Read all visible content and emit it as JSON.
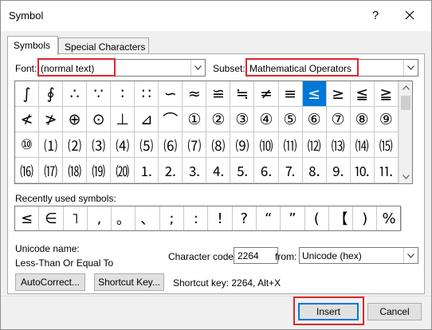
{
  "window": {
    "title": "Symbol",
    "help_glyph": "?"
  },
  "tabs": [
    {
      "label": "Symbols",
      "active": true
    },
    {
      "label": "Special Characters",
      "active": false
    }
  ],
  "font": {
    "label": "Font:",
    "value": "(normal text)"
  },
  "subset": {
    "label": "Subset:",
    "value": "Mathematical Operators"
  },
  "symbol_grid": {
    "selected_index": 12,
    "rows": [
      [
        "∫",
        "∮",
        "∴",
        "∵",
        "∶",
        "∷",
        "∽",
        "≈",
        "≌",
        "≒",
        "≠",
        "≡",
        "≤",
        "≥",
        "≦",
        "≧"
      ],
      [
        "≮",
        "≯",
        "⊕",
        "⊙",
        "⊥",
        "⊿",
        "⌒",
        "①",
        "②",
        "③",
        "④",
        "⑤",
        "⑥",
        "⑦",
        "⑧",
        "⑨"
      ],
      [
        "⑩",
        "⑴",
        "⑵",
        "⑶",
        "⑷",
        "⑸",
        "⑹",
        "⑺",
        "⑻",
        "⑼",
        "⑽",
        "⑾",
        "⑿",
        "⒀",
        "⒁",
        "⒂"
      ],
      [
        "⒃",
        "⒄",
        "⒅",
        "⒆",
        "⒇",
        "⒈",
        "⒉",
        "⒊",
        "⒋",
        "⒌",
        "⒍",
        "⒎",
        "⒏",
        "⒐",
        "⒑",
        "⒒"
      ]
    ]
  },
  "recently_used": {
    "label": "Recently used symbols:",
    "symbols": [
      "≤",
      "∈",
      "˥",
      ",",
      "。",
      "、",
      ";",
      ":",
      "!",
      "?",
      "“",
      "”",
      "(",
      "【",
      ")",
      "%"
    ]
  },
  "unicode_name": {
    "label": "Unicode name:",
    "value": "Less-Than Or Equal To"
  },
  "character_code": {
    "label": "Character code:",
    "value": "2264"
  },
  "from": {
    "label": "from:",
    "value": "Unicode (hex)"
  },
  "buttons": {
    "autocorrect": "AutoCorrect...",
    "shortcut_key": "Shortcut Key...",
    "insert": "Insert",
    "cancel": "Cancel"
  },
  "shortcut_text": "Shortcut key: 2264, Alt+X",
  "colors": {
    "selection": "#0078d7",
    "highlight_box": "#e0262c"
  }
}
